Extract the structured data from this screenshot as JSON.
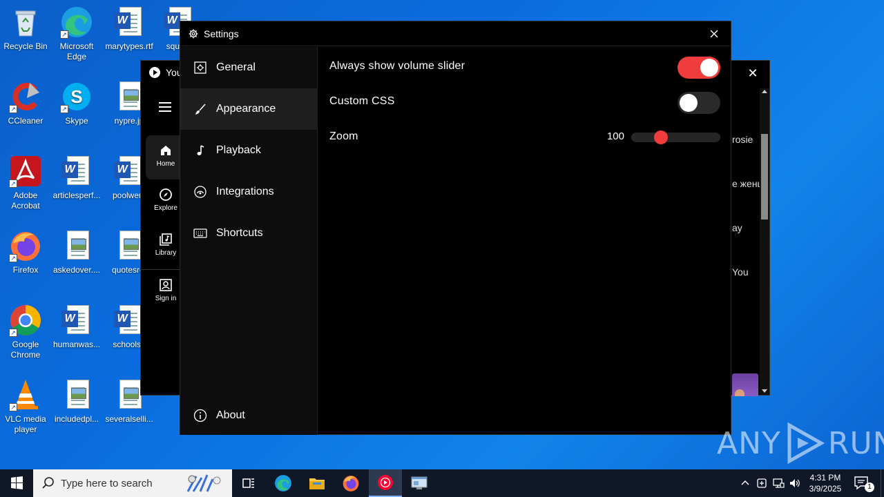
{
  "desktop": {
    "icons": [
      {
        "label": "Recycle Bin"
      },
      {
        "label": "Microsoft Edge"
      },
      {
        "label": "marytypes.rtf"
      },
      {
        "label": "square"
      },
      {
        "label": "CCleaner"
      },
      {
        "label": "Skype"
      },
      {
        "label": "nypre.jp"
      },
      {
        "label": "Adobe Acrobat"
      },
      {
        "label": "articlesperf..."
      },
      {
        "label": "poolwent"
      },
      {
        "label": "Firefox"
      },
      {
        "label": "askedover...."
      },
      {
        "label": "quotesret"
      },
      {
        "label": "Google Chrome"
      },
      {
        "label": "humanwas..."
      },
      {
        "label": "schoolse"
      },
      {
        "label": "VLC media player"
      },
      {
        "label": "includedpl..."
      },
      {
        "label": "severalselli..."
      }
    ]
  },
  "ytm_window": {
    "title": "You",
    "close_glyph": "✕",
    "nav": [
      {
        "label": "Home",
        "icon": "home-icon"
      },
      {
        "label": "Explore",
        "icon": "compass-icon"
      },
      {
        "label": "Library",
        "icon": "library-icon"
      },
      {
        "label": "Sign in",
        "icon": "account-icon"
      }
    ],
    "side_texts": [
      "rosie",
      "e женщ",
      "ay",
      "You"
    ]
  },
  "settings": {
    "title": "Settings",
    "sidebar": [
      {
        "label": "General",
        "icon": "general-icon"
      },
      {
        "label": "Appearance",
        "icon": "brush-icon"
      },
      {
        "label": "Playback",
        "icon": "music-note-icon"
      },
      {
        "label": "Integrations",
        "icon": "integrations-icon"
      },
      {
        "label": "Shortcuts",
        "icon": "keyboard-icon"
      }
    ],
    "about_label": "About",
    "active_item": "Appearance",
    "options": {
      "volume_slider": {
        "label": "Always show volume slider",
        "enabled": true
      },
      "custom_css": {
        "label": "Custom CSS",
        "enabled": false
      },
      "zoom": {
        "label": "Zoom",
        "value": "100",
        "slider_fraction": 0.3
      }
    },
    "accent_color": "#f03c3c"
  },
  "watermark": {
    "left": "ANY",
    "right": "RUN"
  },
  "taskbar": {
    "search_placeholder": "Type here to search",
    "clock_time": "4:31 PM",
    "clock_date": "3/9/2025",
    "notification_count": "1"
  }
}
